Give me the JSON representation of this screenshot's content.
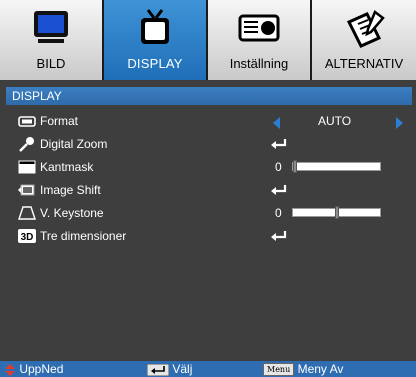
{
  "tabs": [
    {
      "label": "BILD",
      "icon": "monitor-icon",
      "active": false
    },
    {
      "label": "DISPLAY",
      "icon": "tv-icon",
      "active": true
    },
    {
      "label": "Inställning",
      "icon": "projector-icon",
      "active": false
    },
    {
      "label": "ALTERNATIV",
      "icon": "notepad-pen-icon",
      "active": false
    }
  ],
  "menu_title": "DISPLAY",
  "rows": [
    {
      "label": "Format",
      "icon": "aspect-ratio-icon",
      "control": "selector",
      "value": "AUTO"
    },
    {
      "label": "Digital Zoom",
      "icon": "magnifier-icon",
      "control": "enter"
    },
    {
      "label": "Kantmask",
      "icon": "edge-mask-icon",
      "control": "slider",
      "number": "0",
      "level": 0
    },
    {
      "label": "Image Shift",
      "icon": "image-shift-icon",
      "control": "enter"
    },
    {
      "label": "V. Keystone",
      "icon": "keystone-icon",
      "control": "slider",
      "number": "0",
      "level": 0.5
    },
    {
      "label": "Tre dimensioner",
      "icon": "3d-icon",
      "icon_text": "3D",
      "control": "enter"
    }
  ],
  "footer": {
    "updown": "UppNed",
    "select": "Välj",
    "menu_key": "Menu",
    "menu_off": "Meny Av"
  },
  "colors": {
    "active_tab": "#2a7cc7",
    "background": "#3e3e3e",
    "accent": "#2b7fd3",
    "footer": "#2e6db1"
  }
}
